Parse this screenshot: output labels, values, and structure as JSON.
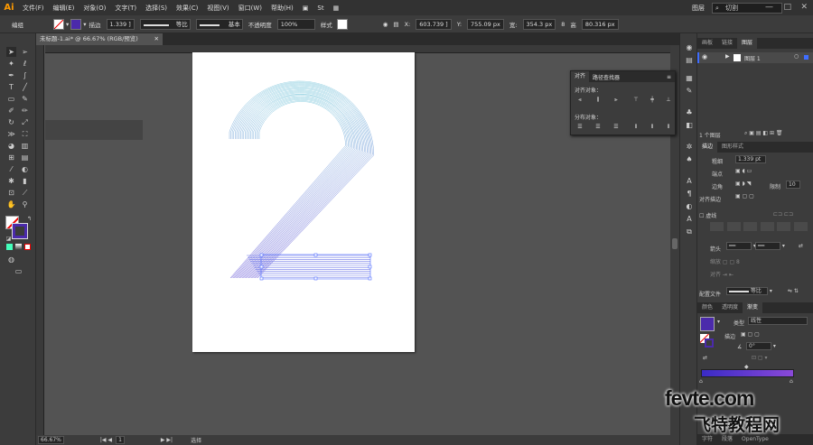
{
  "app": {
    "logo": "Ai"
  },
  "menu": [
    "文件(F)",
    "编辑(E)",
    "对象(O)",
    "文字(T)",
    "选择(S)",
    "效果(C)",
    "视图(V)",
    "窗口(W)",
    "帮助(H)"
  ],
  "workspace": "图层",
  "search_placeholder": "切割",
  "window_controls": [
    "—",
    "□",
    "✕"
  ],
  "control": {
    "mode": "编组",
    "stroke_label": "描边",
    "stroke_weight": "1.339 ]",
    "profile": "等比",
    "brush": "基本",
    "opacity_label": "不透明度",
    "opacity": "100%",
    "style_label": "样式",
    "x": "603.739 ]",
    "y": "755.09 px",
    "w": "354.3 px",
    "h_label": "高",
    "h": "80.316 px"
  },
  "doc_tab": "未标题-1.ai* @ 66.67% (RGB/预览)",
  "status": {
    "zoom": "66.67%",
    "page": "1",
    "tool": "选择"
  },
  "align_panel": {
    "tabs": [
      "对齐",
      "路径查找器"
    ],
    "align_objects": "对齐对象：",
    "distribute_objects": "分布对象："
  },
  "layers_panel": {
    "tabs": [
      "画板",
      "链接",
      "图层"
    ],
    "layer_name": "图层 1",
    "count": "1 个图层"
  },
  "stroke_panel": {
    "tabs": [
      "描边",
      "图形样式"
    ],
    "weight_label": "粗细",
    "weight": "1.339 pt",
    "cap_label": "端点",
    "join_label": "边角",
    "limit_label": "限制",
    "limit": "10",
    "align_label": "对齐描边",
    "dashed_label": "虚线",
    "arrow_label": "箭头",
    "profile_label": "配置文件",
    "profile_value": "等比"
  },
  "gradient_panel": {
    "tabs": [
      "颜色",
      "透明度",
      "渐变"
    ],
    "type_label": "类型",
    "type": "线性",
    "stroke_label": "描边",
    "angle": "0°"
  },
  "bottom_tabs": [
    "字符",
    "段落",
    "OpenType"
  ],
  "colors": {
    "grad_start": "#3a2bc5",
    "grad_end": "#8a49d8",
    "shape_top": "#8fcfe0",
    "shape_bottom": "#6a5ad8"
  },
  "watermark": {
    "line1": "fevte.com",
    "line2": "飞特教程网"
  }
}
